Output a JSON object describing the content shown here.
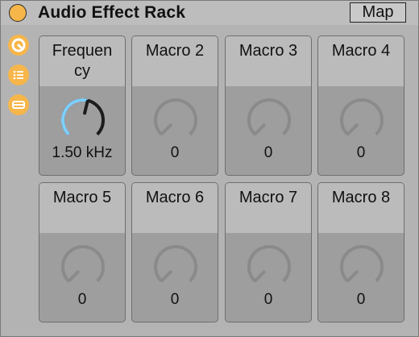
{
  "device": {
    "title": "Audio Effect Rack",
    "map_label": "Map",
    "accent_color": "#f6b64a",
    "knob_active_color": "#7fcfff"
  },
  "sidebar": {
    "buttons": [
      {
        "icon": "macro-knob-icon"
      },
      {
        "icon": "chain-list-icon"
      },
      {
        "icon": "device-view-icon"
      }
    ]
  },
  "macros": [
    {
      "label": "Frequen\ncy",
      "value": "1.50 kHz",
      "level": 0.55,
      "active": true
    },
    {
      "label": "Macro 2",
      "value": "0",
      "level": 0,
      "active": false
    },
    {
      "label": "Macro 3",
      "value": "0",
      "level": 0,
      "active": false
    },
    {
      "label": "Macro 4",
      "value": "0",
      "level": 0,
      "active": false
    },
    {
      "label": "Macro 5",
      "value": "0",
      "level": 0,
      "active": false
    },
    {
      "label": "Macro 6",
      "value": "0",
      "level": 0,
      "active": false
    },
    {
      "label": "Macro 7",
      "value": "0",
      "level": 0,
      "active": false
    },
    {
      "label": "Macro 8",
      "value": "0",
      "level": 0,
      "active": false
    }
  ]
}
